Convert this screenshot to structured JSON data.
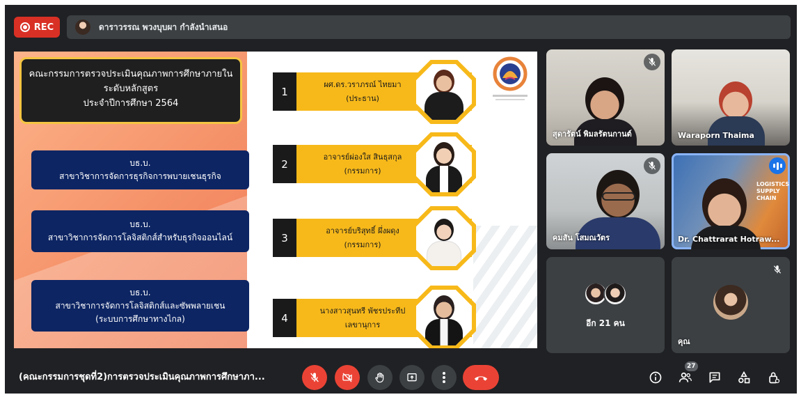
{
  "header": {
    "rec_label": "REC",
    "presenter_text": "ดาราวรรณ พวงบุบผา กำลังนำเสนอ"
  },
  "slide": {
    "title_line1": "คณะกรรมการตรวจประเมินคุณภาพการศึกษาภายใน",
    "title_line2": "ระดับหลักสูตร",
    "title_line3": "ประจำปีการศึกษา 2564",
    "programs": [
      {
        "degree": "บธ.บ.",
        "line1": "สาขาวิชาการจัดการธุรกิจการพบายเชนธุรกิจ",
        "line2": ""
      },
      {
        "degree": "บธ.บ.",
        "line1": "สาขาวิชาการจัดการโลจิสติกส์สำหรับธุรกิจออนไลน์",
        "line2": ""
      },
      {
        "degree": "บธ.บ.",
        "line1": "สาขาวิชาการจัดการโลจิสติกส์และซัพพลายเชน",
        "line2": "(ระบบการศึกษาทางไกล)"
      }
    ],
    "members": [
      {
        "num": "1",
        "name": "ผศ.ดร.วราภรณ์  ไทยมา",
        "role": "(ประธาน)"
      },
      {
        "num": "2",
        "name": "อาจารย์ผ่องใส สินธุสกุล",
        "role": "(กรรมการ)"
      },
      {
        "num": "3",
        "name": "อาจารย์บริสุทธิ์ ผึ่งผดุง",
        "role": "(กรรมการ)"
      },
      {
        "num": "4",
        "name": "นางสาวสุนทรี  พัชรประทีป",
        "role": "เลขานุการ"
      }
    ]
  },
  "tiles": [
    {
      "name": "สุดารัตน์ พิมลรัตนกานต์",
      "muted": true
    },
    {
      "name": "Waraporn Thaima",
      "muted": false
    },
    {
      "name": "คมสัน โสมณวัตร",
      "muted": true
    },
    {
      "name": "Dr. Chattrarat Hotraw...",
      "speaking": true
    },
    {
      "name": "อีก 21 คน"
    },
    {
      "name": "คุณ",
      "muted": true
    }
  ],
  "footer": {
    "meeting_title": "(คณะกรรมการชุดที่2)การตรวจประเมินคุณภาพการศึกษาภา...",
    "participant_count": "27"
  },
  "colors": {
    "background": "#202124",
    "tile": "#3c4043",
    "danger": "#ea4335",
    "slide_navy": "#0d2563",
    "slide_yellow": "#f7b91a",
    "speaking_outline": "#8ab4f8"
  }
}
